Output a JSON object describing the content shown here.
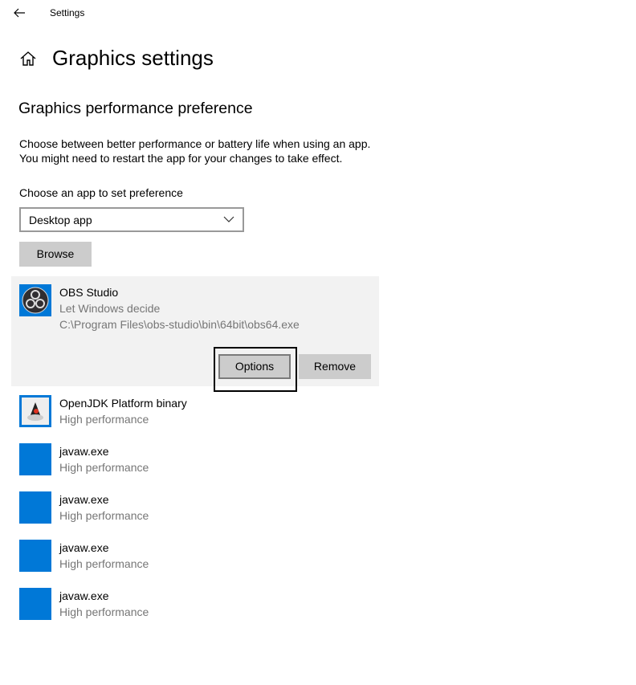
{
  "window": {
    "title": "Settings"
  },
  "page": {
    "title": "Graphics settings",
    "subtitle": "Graphics performance preference",
    "desc1": "Choose between better performance or battery life when using an app.",
    "desc2": "You might need to restart the app for your changes to take effect.",
    "choose_label": "Choose an app to set preference",
    "dropdown_value": "Desktop app",
    "browse": "Browse"
  },
  "selected": {
    "name": "OBS Studio",
    "status": "Let Windows decide",
    "path": "C:\\Program Files\\obs-studio\\bin\\64bit\\obs64.exe",
    "options": "Options",
    "remove": "Remove"
  },
  "apps": [
    {
      "name": "OpenJDK Platform binary",
      "status": "High performance"
    },
    {
      "name": "javaw.exe",
      "status": "High performance"
    },
    {
      "name": "javaw.exe",
      "status": "High performance"
    },
    {
      "name": "javaw.exe",
      "status": "High performance"
    },
    {
      "name": "javaw.exe",
      "status": "High performance"
    }
  ],
  "colors": {
    "accent": "#0078d7",
    "card": "#f2f2f2",
    "button": "#cccccc"
  }
}
